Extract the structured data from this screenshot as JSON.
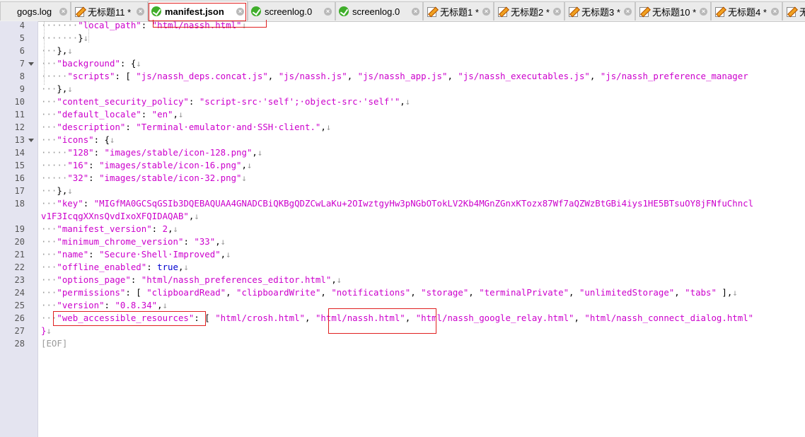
{
  "tabs": [
    {
      "label": "gogs.log",
      "icon": "gogs-log-icon",
      "close": "close-icon",
      "active": false
    },
    {
      "label": "无标题11 *",
      "icon": "modified-file-icon",
      "close": "close-icon",
      "active": false
    },
    {
      "label": "manifest.json",
      "icon": "saved-file-icon",
      "close": "close-icon",
      "active": true
    },
    {
      "label": "screenlog.0",
      "icon": "saved-file-icon",
      "close": "close-icon",
      "active": false
    },
    {
      "label": "screenlog.0",
      "icon": "saved-file-icon",
      "close": "close-icon",
      "active": false
    },
    {
      "label": "无标题1 *",
      "icon": "modified-file-icon",
      "close": "close-icon",
      "active": false
    },
    {
      "label": "无标题2 *",
      "icon": "modified-file-icon",
      "close": "close-icon",
      "active": false
    },
    {
      "label": "无标题3 *",
      "icon": "modified-file-icon",
      "close": "close-icon",
      "active": false
    },
    {
      "label": "无标题10 *",
      "icon": "modified-file-icon",
      "close": "close-icon",
      "active": false
    },
    {
      "label": "无标题4 *",
      "icon": "modified-file-icon",
      "close": "close-icon",
      "active": false
    },
    {
      "label": "无",
      "icon": "modified-file-icon",
      "close": "",
      "active": false
    }
  ],
  "line_numbers": [
    "4",
    "5",
    "6",
    "7",
    "8",
    "9",
    "10",
    "11",
    "12",
    "13",
    "14",
    "15",
    "16",
    "17",
    "18",
    "",
    "19",
    "20",
    "21",
    "22",
    "23",
    "24",
    "25",
    "26",
    "27",
    "28"
  ],
  "fold_markers": [
    "7",
    "13"
  ],
  "colors": {
    "string": "#cc00cc",
    "keyword": "#0000d0",
    "whitespace_marker": "#9a9a9a",
    "highlight_box": "#e02020",
    "gutter": "#e4e4f0"
  },
  "code": [
    [
      {
        "t": "·······",
        "c": "ws"
      },
      {
        "t": "\"local_path\"",
        "c": "str"
      },
      {
        "t": ": ",
        "c": ""
      },
      {
        "t": "\"html/nassh.html\"",
        "c": "str"
      },
      {
        "t": "↓",
        "c": "ws"
      }
    ],
    [
      {
        "t": "·······",
        "c": "ws"
      },
      {
        "t": "}",
        "c": ""
      },
      {
        "t": "↓",
        "c": "ws"
      }
    ],
    [
      {
        "t": "···",
        "c": "ws"
      },
      {
        "t": "},",
        "c": ""
      },
      {
        "t": "↓",
        "c": "ws"
      }
    ],
    [
      {
        "t": "···",
        "c": "ws"
      },
      {
        "t": "\"background\"",
        "c": "str"
      },
      {
        "t": ": {",
        "c": ""
      },
      {
        "t": "↓",
        "c": "ws"
      }
    ],
    [
      {
        "t": "·····",
        "c": "ws"
      },
      {
        "t": "\"scripts\"",
        "c": "str"
      },
      {
        "t": ": [ ",
        "c": ""
      },
      {
        "t": "\"js/nassh_deps.concat.js\"",
        "c": "str"
      },
      {
        "t": ", ",
        "c": ""
      },
      {
        "t": "\"js/nassh.js\"",
        "c": "str"
      },
      {
        "t": ", ",
        "c": ""
      },
      {
        "t": "\"js/nassh_app.js\"",
        "c": "str"
      },
      {
        "t": ", ",
        "c": ""
      },
      {
        "t": "\"js/nassh_executables.js\"",
        "c": "str"
      },
      {
        "t": ", ",
        "c": ""
      },
      {
        "t": "\"js/nassh_preference_manager",
        "c": "str"
      }
    ],
    [
      {
        "t": "···",
        "c": "ws"
      },
      {
        "t": "},",
        "c": ""
      },
      {
        "t": "↓",
        "c": "ws"
      }
    ],
    [
      {
        "t": "···",
        "c": "ws"
      },
      {
        "t": "\"content_security_policy\"",
        "c": "str"
      },
      {
        "t": ": ",
        "c": ""
      },
      {
        "t": "\"script-src·'self';·object-src·'self'\"",
        "c": "str"
      },
      {
        "t": ",",
        "c": ""
      },
      {
        "t": "↓",
        "c": "ws"
      }
    ],
    [
      {
        "t": "···",
        "c": "ws"
      },
      {
        "t": "\"default_locale\"",
        "c": "str"
      },
      {
        "t": ": ",
        "c": ""
      },
      {
        "t": "\"en\"",
        "c": "str"
      },
      {
        "t": ",",
        "c": ""
      },
      {
        "t": "↓",
        "c": "ws"
      }
    ],
    [
      {
        "t": "···",
        "c": "ws"
      },
      {
        "t": "\"description\"",
        "c": "str"
      },
      {
        "t": ": ",
        "c": ""
      },
      {
        "t": "\"Terminal·emulator·and·SSH·client.\"",
        "c": "str"
      },
      {
        "t": ",",
        "c": ""
      },
      {
        "t": "↓",
        "c": "ws"
      }
    ],
    [
      {
        "t": "···",
        "c": "ws"
      },
      {
        "t": "\"icons\"",
        "c": "str"
      },
      {
        "t": ": {",
        "c": ""
      },
      {
        "t": "↓",
        "c": "ws"
      }
    ],
    [
      {
        "t": "·····",
        "c": "ws"
      },
      {
        "t": "\"128\"",
        "c": "str"
      },
      {
        "t": ": ",
        "c": ""
      },
      {
        "t": "\"images/stable/icon-128.png\"",
        "c": "str"
      },
      {
        "t": ",",
        "c": ""
      },
      {
        "t": "↓",
        "c": "ws"
      }
    ],
    [
      {
        "t": "·····",
        "c": "ws"
      },
      {
        "t": "\"16\"",
        "c": "str"
      },
      {
        "t": ": ",
        "c": ""
      },
      {
        "t": "\"images/stable/icon-16.png\"",
        "c": "str"
      },
      {
        "t": ",",
        "c": ""
      },
      {
        "t": "↓",
        "c": "ws"
      }
    ],
    [
      {
        "t": "·····",
        "c": "ws"
      },
      {
        "t": "\"32\"",
        "c": "str"
      },
      {
        "t": ": ",
        "c": ""
      },
      {
        "t": "\"images/stable/icon-32.png\"",
        "c": "str"
      },
      {
        "t": "↓",
        "c": "ws"
      }
    ],
    [
      {
        "t": "···",
        "c": "ws"
      },
      {
        "t": "},",
        "c": ""
      },
      {
        "t": "↓",
        "c": "ws"
      }
    ],
    [
      {
        "t": "···",
        "c": "ws"
      },
      {
        "t": "\"key\"",
        "c": "str"
      },
      {
        "t": ": ",
        "c": ""
      },
      {
        "t": "\"MIGfMA0GCSqGSIb3DQEBAQUAA4GNADCBiQKBgQDZCwLaKu+2OIwztgyHw3pNGbOTokLV2Kb4MGnZGnxKTozx87Wf7aQZWzBtGBi4iys1HE5BTsuOY8jFNfuChncl",
        "c": "str"
      }
    ],
    [
      {
        "t": "v1F3IcqgXXnsQvdIxoXFQIDAQAB\"",
        "c": "str"
      },
      {
        "t": ",",
        "c": ""
      },
      {
        "t": "↓",
        "c": "ws"
      }
    ],
    [
      {
        "t": "···",
        "c": "ws"
      },
      {
        "t": "\"manifest_version\"",
        "c": "str"
      },
      {
        "t": ": ",
        "c": ""
      },
      {
        "t": "2",
        "c": "str"
      },
      {
        "t": ",",
        "c": ""
      },
      {
        "t": "↓",
        "c": "ws"
      }
    ],
    [
      {
        "t": "···",
        "c": "ws"
      },
      {
        "t": "\"minimum_chrome_version\"",
        "c": "str"
      },
      {
        "t": ": ",
        "c": ""
      },
      {
        "t": "\"33\"",
        "c": "str"
      },
      {
        "t": ",",
        "c": ""
      },
      {
        "t": "↓",
        "c": "ws"
      }
    ],
    [
      {
        "t": "···",
        "c": "ws"
      },
      {
        "t": "\"name\"",
        "c": "str"
      },
      {
        "t": ": ",
        "c": ""
      },
      {
        "t": "\"Secure·Shell·Improved\"",
        "c": "str"
      },
      {
        "t": ",",
        "c": ""
      },
      {
        "t": "↓",
        "c": "ws"
      }
    ],
    [
      {
        "t": "···",
        "c": "ws"
      },
      {
        "t": "\"offline_enabled\"",
        "c": "str"
      },
      {
        "t": ": ",
        "c": ""
      },
      {
        "t": "true",
        "c": "kw"
      },
      {
        "t": ",",
        "c": ""
      },
      {
        "t": "↓",
        "c": "ws"
      }
    ],
    [
      {
        "t": "···",
        "c": "ws"
      },
      {
        "t": "\"options_page\"",
        "c": "str"
      },
      {
        "t": ": ",
        "c": ""
      },
      {
        "t": "\"html/nassh_preferences_editor.html\"",
        "c": "str"
      },
      {
        "t": ",",
        "c": ""
      },
      {
        "t": "↓",
        "c": "ws"
      }
    ],
    [
      {
        "t": "···",
        "c": "ws"
      },
      {
        "t": "\"permissions\"",
        "c": "str"
      },
      {
        "t": ": [ ",
        "c": ""
      },
      {
        "t": "\"clipboardRead\"",
        "c": "str"
      },
      {
        "t": ", ",
        "c": ""
      },
      {
        "t": "\"clipboardWrite\"",
        "c": "str"
      },
      {
        "t": ", ",
        "c": ""
      },
      {
        "t": "\"notifications\"",
        "c": "str"
      },
      {
        "t": ", ",
        "c": ""
      },
      {
        "t": "\"storage\"",
        "c": "str"
      },
      {
        "t": ", ",
        "c": ""
      },
      {
        "t": "\"terminalPrivate\"",
        "c": "str"
      },
      {
        "t": ", ",
        "c": ""
      },
      {
        "t": "\"unlimitedStorage\"",
        "c": "str"
      },
      {
        "t": ", ",
        "c": ""
      },
      {
        "t": "\"tabs\"",
        "c": "str"
      },
      {
        "t": " ],",
        "c": ""
      },
      {
        "t": "↓",
        "c": "ws"
      }
    ],
    [
      {
        "t": "···",
        "c": "ws"
      },
      {
        "t": "\"version\"",
        "c": "str"
      },
      {
        "t": ": ",
        "c": ""
      },
      {
        "t": "\"0.8.34\"",
        "c": "str"
      },
      {
        "t": ",",
        "c": ""
      },
      {
        "t": "↓",
        "c": "ws"
      }
    ],
    [
      {
        "t": "···",
        "c": "ws"
      },
      {
        "t": "\"web_accessible_resources\"",
        "c": "str"
      },
      {
        "t": ": [ ",
        "c": ""
      },
      {
        "t": "\"html/crosh.html\"",
        "c": "str"
      },
      {
        "t": ", ",
        "c": ""
      },
      {
        "t": "\"html/nassh.html\"",
        "c": "str"
      },
      {
        "t": ", ",
        "c": ""
      },
      {
        "t": "\"html/nassh_google_relay.html\"",
        "c": "str"
      },
      {
        "t": ", ",
        "c": ""
      },
      {
        "t": "\"html/nassh_connect_dialog.html\"",
        "c": "str"
      }
    ],
    [
      {
        "t": "}",
        "c": "str"
      },
      {
        "t": "↓",
        "c": "ws"
      }
    ],
    [
      {
        "t": "[EOF]",
        "c": "eof"
      }
    ]
  ]
}
